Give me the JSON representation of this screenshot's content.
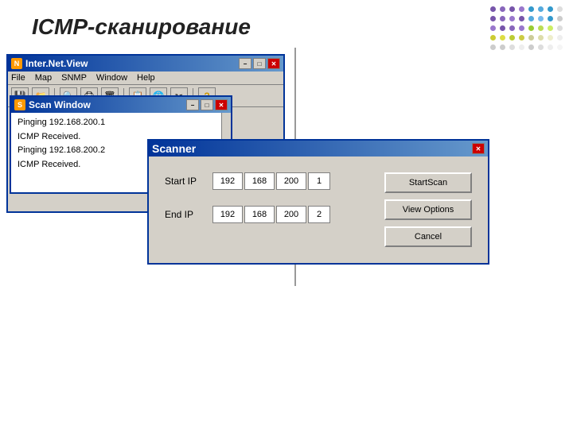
{
  "page": {
    "title": "ICMP-сканирование"
  },
  "dots": [
    {
      "color": "#7755aa"
    },
    {
      "color": "#8866bb"
    },
    {
      "color": "#7755aa"
    },
    {
      "color": "#9977cc"
    },
    {
      "color": "#3399cc"
    },
    {
      "color": "#55aadd"
    },
    {
      "color": "#3399cc"
    },
    {
      "color": "#dddddd"
    },
    {
      "color": "#7755aa"
    },
    {
      "color": "#8866bb"
    },
    {
      "color": "#9977cc"
    },
    {
      "color": "#7755aa"
    },
    {
      "color": "#55aadd"
    },
    {
      "color": "#77bbee"
    },
    {
      "color": "#3399cc"
    },
    {
      "color": "#cccccc"
    },
    {
      "color": "#9977cc"
    },
    {
      "color": "#7755aa"
    },
    {
      "color": "#8866bb"
    },
    {
      "color": "#9977cc"
    },
    {
      "color": "#99cc33"
    },
    {
      "color": "#bbdd55"
    },
    {
      "color": "#ccee66"
    },
    {
      "color": "#dddddd"
    },
    {
      "color": "#cccc33"
    },
    {
      "color": "#dddd44"
    },
    {
      "color": "#bbcc33"
    },
    {
      "color": "#cccc44"
    },
    {
      "color": "#cccc99"
    },
    {
      "color": "#ddddaa"
    },
    {
      "color": "#eeeecc"
    },
    {
      "color": "#eeeeee"
    },
    {
      "color": "#cccccc"
    },
    {
      "color": "#cccccc"
    },
    {
      "color": "#dddddd"
    },
    {
      "color": "#eeeeee"
    },
    {
      "color": "#cccccc"
    },
    {
      "color": "#dddddd"
    },
    {
      "color": "#eeeeee"
    },
    {
      "color": "#f5f5f5"
    }
  ],
  "internetview": {
    "title": "Inter.Net.View",
    "icon_label": "N",
    "menu_items": [
      "File",
      "Map",
      "SNMP",
      "Window",
      "Help"
    ],
    "toolbar_icons": [
      "💾",
      "🔍",
      "🖨",
      "🗑",
      "📋",
      "🌐",
      "✂",
      "?"
    ],
    "min_label": "−",
    "max_label": "□",
    "close_label": "✕"
  },
  "scan_window": {
    "title": "Scan Window",
    "icon_label": "S",
    "min_label": "−",
    "max_label": "□",
    "close_label": "✕",
    "lines": [
      "Pinging 192.168.200.1",
      "ICMP Received.",
      "Pinging 192.168.200.2",
      "ICMP Received."
    ]
  },
  "scanner": {
    "title": "Scanner",
    "close_label": "✕",
    "start_ip": {
      "label": "Start IP",
      "oct1": "192",
      "oct2": "168",
      "oct3": "200",
      "oct4": "1"
    },
    "end_ip": {
      "label": "End IP",
      "oct1": "192",
      "oct2": "168",
      "oct3": "200",
      "oct4": "2"
    },
    "buttons": {
      "start_scan": "StartScan",
      "view_options": "View Options",
      "cancel": "Cancel"
    }
  }
}
